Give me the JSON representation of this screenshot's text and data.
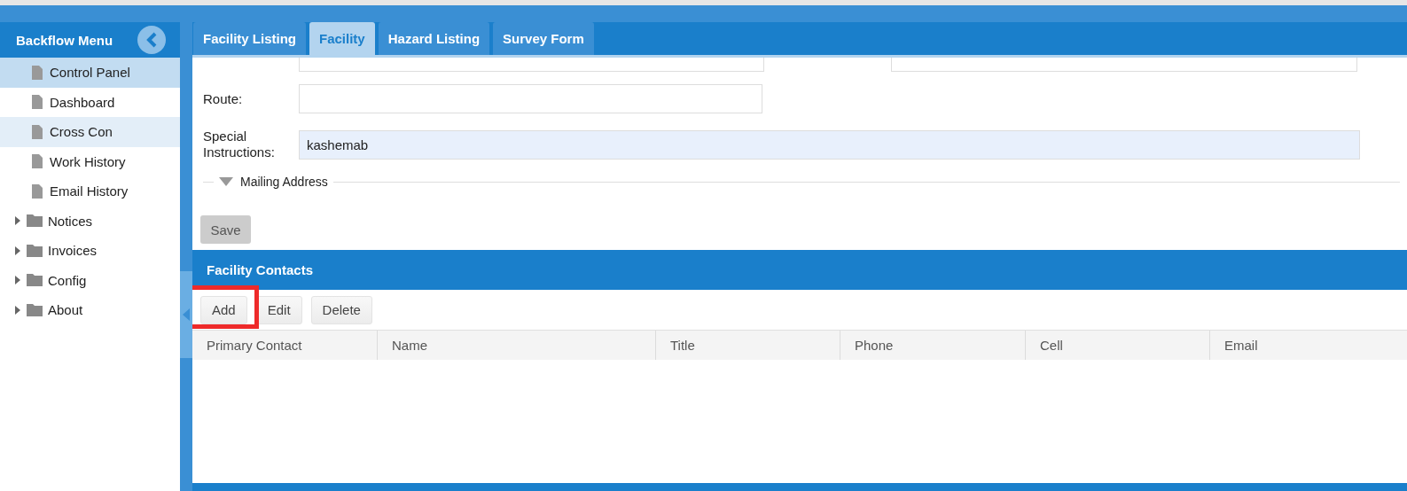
{
  "sidebar": {
    "title": "Backflow Menu",
    "items": [
      {
        "kind": "page",
        "label": "Control Panel",
        "selected": true,
        "hovered": false
      },
      {
        "kind": "page",
        "label": "Dashboard",
        "selected": false,
        "hovered": false
      },
      {
        "kind": "page",
        "label": "Cross Con",
        "selected": false,
        "hovered": true
      },
      {
        "kind": "page",
        "label": "Work History",
        "selected": false,
        "hovered": false
      },
      {
        "kind": "page",
        "label": "Email History",
        "selected": false,
        "hovered": false
      },
      {
        "kind": "folder",
        "label": "Notices",
        "expanded": false
      },
      {
        "kind": "folder",
        "label": "Invoices",
        "expanded": false
      },
      {
        "kind": "folder",
        "label": "Config",
        "expanded": false
      },
      {
        "kind": "folder",
        "label": "About",
        "expanded": false
      }
    ]
  },
  "tabs": [
    {
      "label": "Facility Listing",
      "selected": false
    },
    {
      "label": "Facility",
      "selected": true
    },
    {
      "label": "Hazard Listing",
      "selected": false
    },
    {
      "label": "Survey Form",
      "selected": false
    }
  ],
  "form": {
    "route": {
      "label": "Route:"
    },
    "special_instructions": {
      "label": "Special Instructions:",
      "value": "kashemab"
    },
    "mailing_address": {
      "legend": "Mailing Address"
    },
    "save_button": "Save"
  },
  "contacts": {
    "title": "Facility Contacts",
    "buttons": [
      {
        "label": "Add",
        "highlighted": true
      },
      {
        "label": "Edit",
        "highlighted": false
      },
      {
        "label": "Delete",
        "highlighted": false
      }
    ],
    "columns": [
      "Primary Contact",
      "Name",
      "Title",
      "Phone",
      "Cell",
      "Email"
    ]
  }
}
